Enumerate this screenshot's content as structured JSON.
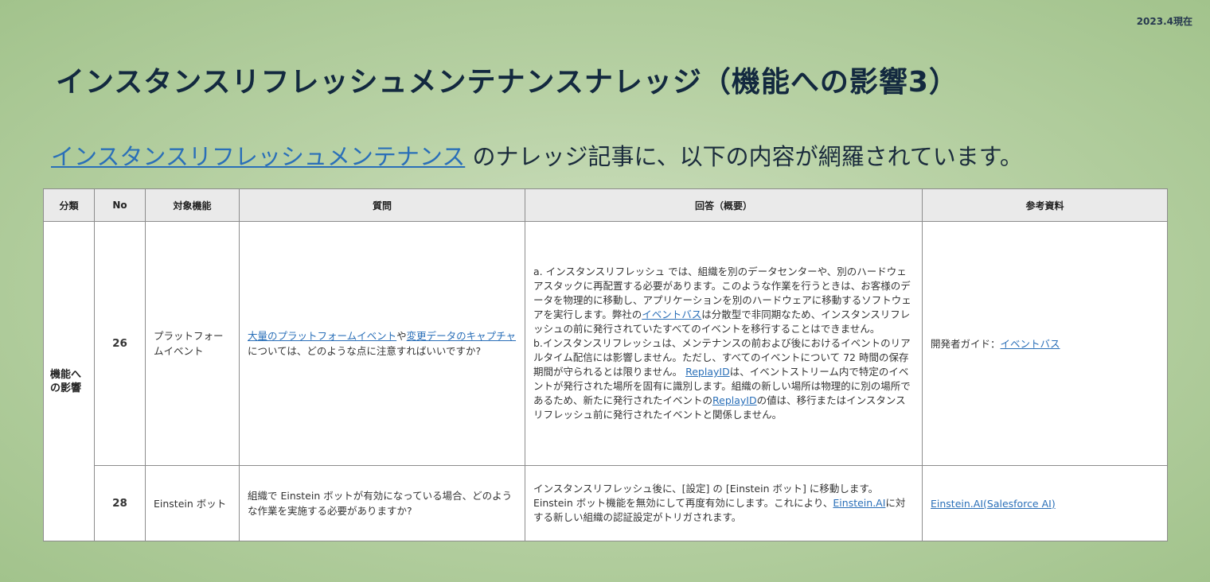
{
  "date_label": "2023.4現在",
  "title": "インスタンスリフレッシュメンテナンスナレッジ（機能への影響3）",
  "subtitle": {
    "link_text": "インスタンスリフレッシュメンテナンス",
    "rest_text": " のナレッジ記事に、以下の内容が網羅されています。"
  },
  "table": {
    "headers": {
      "category": "分類",
      "no": "No",
      "feature": "対象機能",
      "question": "質問",
      "answer": "回答（概要）",
      "reference": "参考資料"
    },
    "category": "機能への影響",
    "rows": [
      {
        "no": "26",
        "feature": "プラットフォームイベント",
        "question": {
          "link1": "大量のプラットフォームイベント",
          "t1": "や",
          "link2": "変更データのキャプチャ",
          "t2": "については、どのような点に注意すればいいですか?"
        },
        "answer": {
          "a1": "a. インスタンスリフレッシュ では、組織を別のデータセンターや、別のハードウェアスタックに再配置する必要があります。このような作業を行うときは、お客様のデータを物理的に移動し、アプリケーションを別のハードウェアに移動するソフトウェアを実行します。弊社の",
          "a_link": "イベントバス",
          "a2": "は分散型で非同期なため、インスタンスリフレッシュの前に発行されていたすべてのイベントを移行することはできません。",
          "b1": "b.インスタンスリフレッシュは、メンテナンスの前および後におけるイベントのリアルタイム配信には影響しません。ただし、すべてのイベントについて 72 時間の保存期間が守られるとは限りません。 ",
          "b_link1": "ReplayID",
          "b2": "は、イベントストリーム内で特定のイベントが発行された場所を固有に識別します。組織の新しい場所は物理的に別の場所であるため、新たに発行されたイベントの",
          "b_link2": "ReplayID",
          "b3": "の値は、移行またはインスタンスリフレッシュ前に発行されたイベントと関係しません。"
        },
        "reference": {
          "text": "開発者ガイド：",
          "link": "イベントバス"
        }
      },
      {
        "no": "28",
        "feature": "Einstein ボット",
        "question": "組織で Einstein ボットが有効になっている場合、どのような作業を実施する必要がありますか?",
        "answer": {
          "t1": "インスタンスリフレッシュ後に、[設定] の [Einstein ボット] に移動します。Einstein ボット機能を無効にして再度有効にします。これにより、",
          "link": "Einstein.AI",
          "t2": "に対する新しい組織の認証設定がトリガされます。"
        },
        "reference": {
          "link": "Einstein.AI(Salesforce AI)"
        }
      }
    ]
  }
}
